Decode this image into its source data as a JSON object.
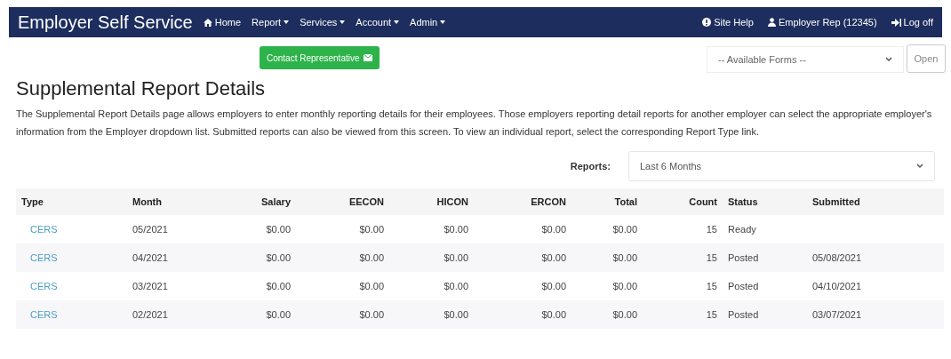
{
  "navbar": {
    "brand": "Employer Self Service",
    "left_items": [
      {
        "kind": "home",
        "label": "Home"
      },
      {
        "kind": "dropdown",
        "label": "Report"
      },
      {
        "kind": "dropdown",
        "label": "Services"
      },
      {
        "kind": "dropdown",
        "label": "Account"
      },
      {
        "kind": "dropdown",
        "label": "Admin"
      }
    ],
    "right_items": [
      {
        "kind": "help",
        "label": "Site Help"
      },
      {
        "kind": "user",
        "label": "Employer Rep (12345)"
      },
      {
        "kind": "logoff",
        "label": "Log off"
      }
    ]
  },
  "contact_button": "Contact Representative",
  "forms_select": {
    "value": "-- Available Forms --"
  },
  "open_button": "Open",
  "page_title": "Supplemental Report Details",
  "description": "The Supplemental Report Details page allows employers to enter monthly reporting details for their employees. Those employers reporting detail reports for another employer can select the appropriate employer's information from the Employer dropdown list. Submitted reports can also be viewed from this screen. To view an individual report, select the corresponding Report Type link.",
  "reports_filter": {
    "label": "Reports:",
    "value": "Last 6 Months"
  },
  "table": {
    "columns": [
      "Type",
      "Month",
      "Salary",
      "EECON",
      "HICON",
      "ERCON",
      "Total",
      "Count",
      "Status",
      "Submitted"
    ],
    "rows": [
      [
        "CERS",
        "05/2021",
        "$0.00",
        "$0.00",
        "$0.00",
        "$0.00",
        "$0.00",
        "15",
        "Ready",
        ""
      ],
      [
        "CERS",
        "04/2021",
        "$0.00",
        "$0.00",
        "$0.00",
        "$0.00",
        "$0.00",
        "15",
        "Posted",
        "05/08/2021"
      ],
      [
        "CERS",
        "03/2021",
        "$0.00",
        "$0.00",
        "$0.00",
        "$0.00",
        "$0.00",
        "15",
        "Posted",
        "04/10/2021"
      ],
      [
        "CERS",
        "02/2021",
        "$0.00",
        "$0.00",
        "$0.00",
        "$0.00",
        "$0.00",
        "15",
        "Posted",
        "03/07/2021"
      ]
    ]
  }
}
